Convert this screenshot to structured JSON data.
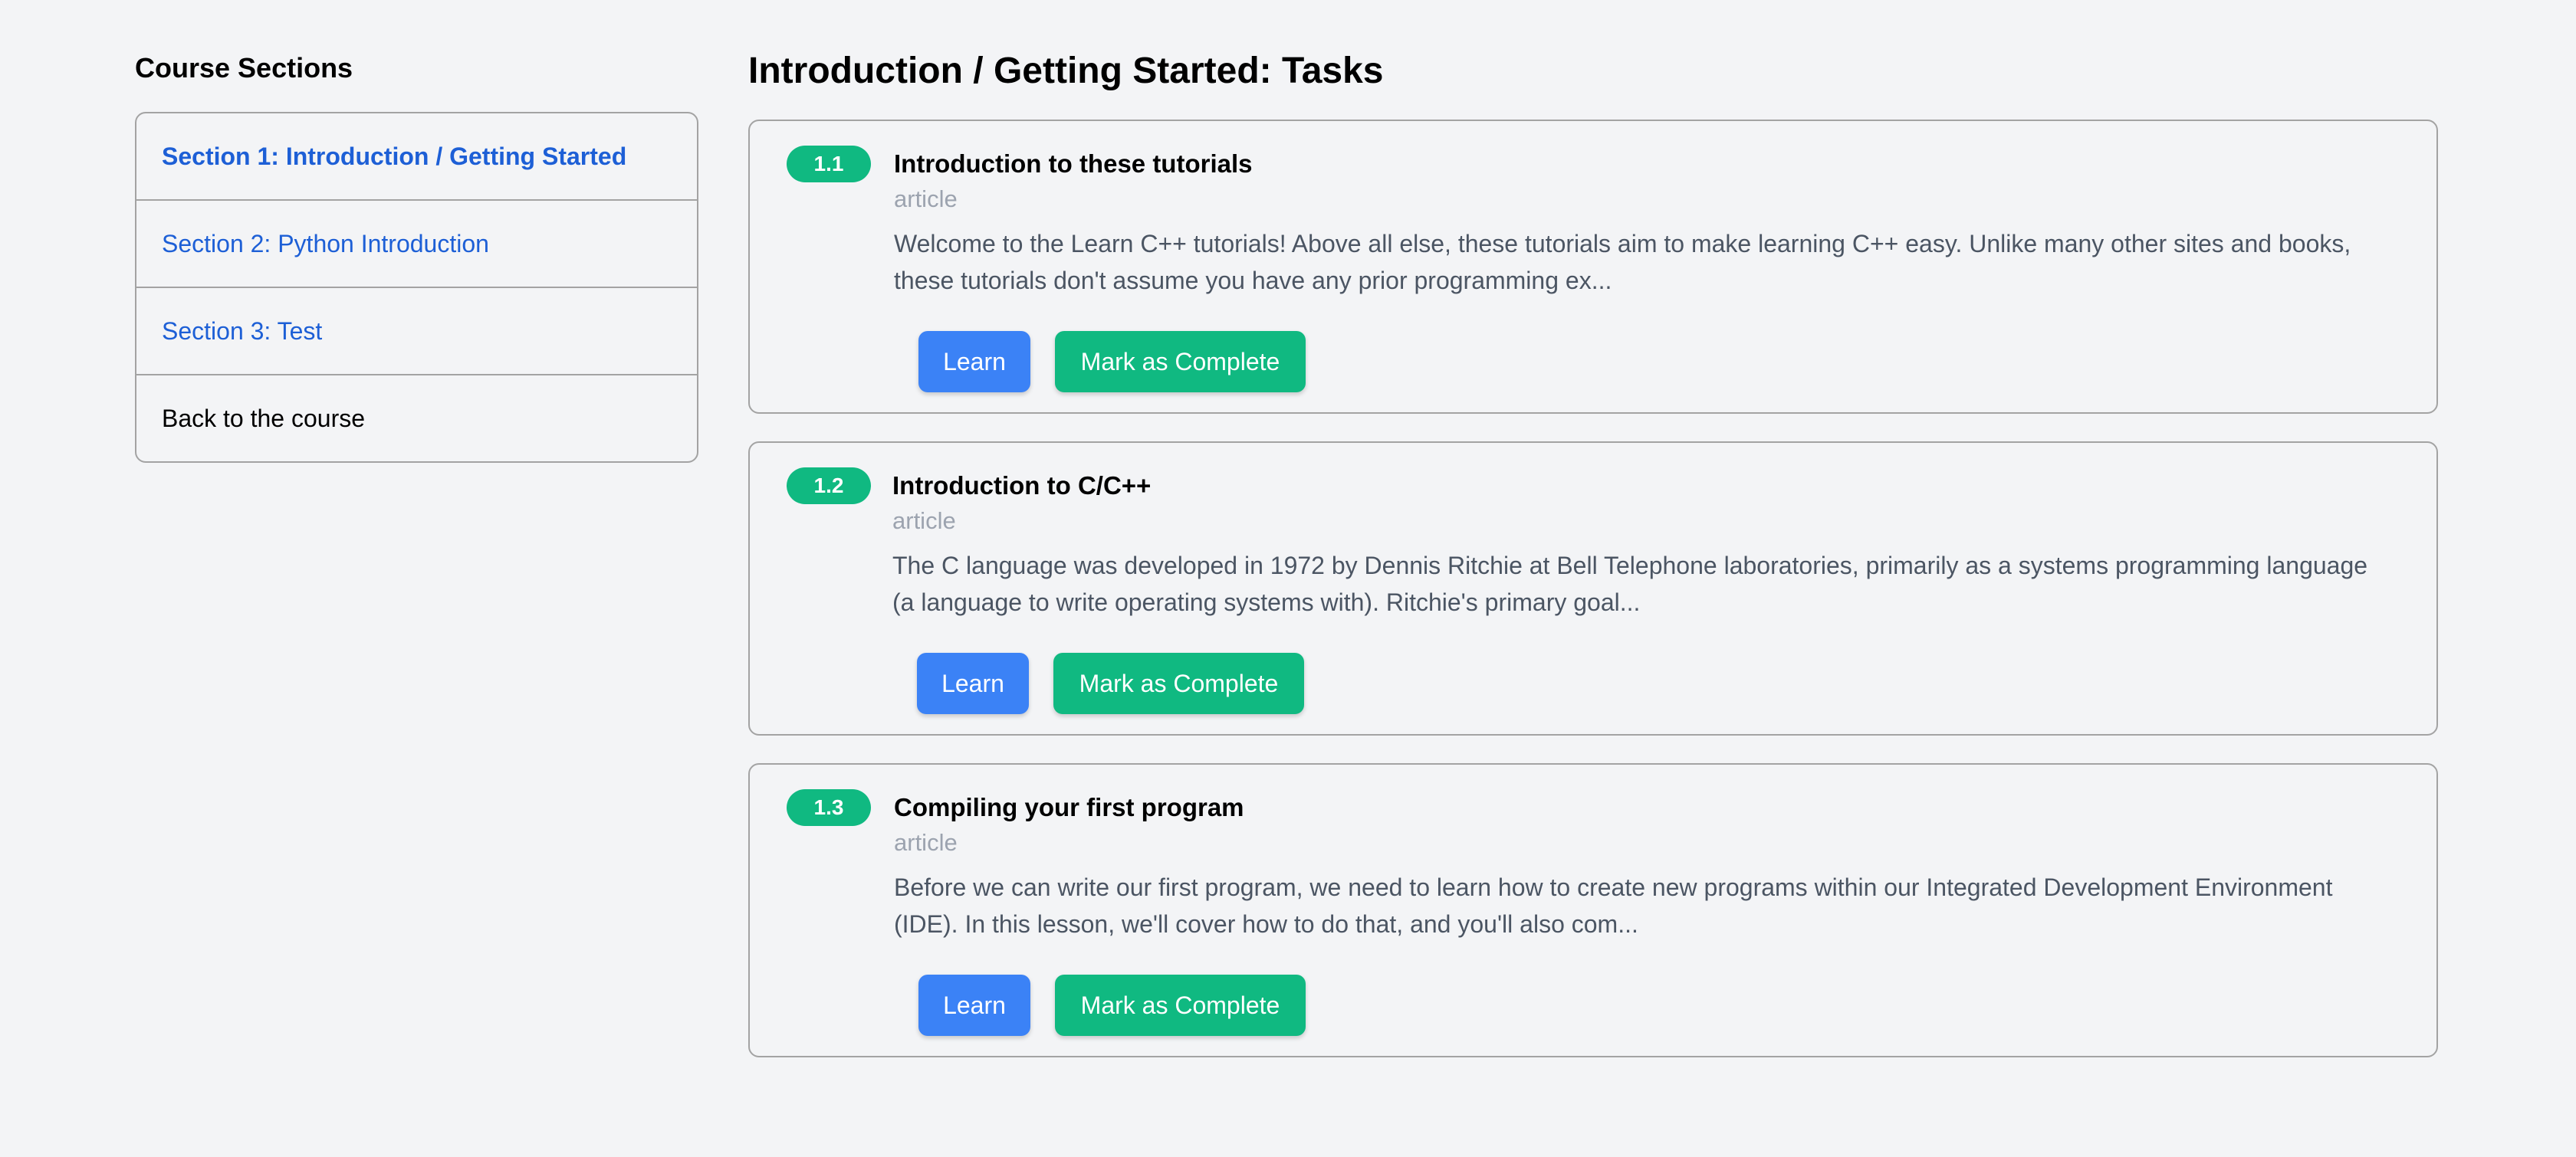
{
  "sidebar": {
    "heading": "Course Sections",
    "items": [
      {
        "label": "Section 1: Introduction / Getting Started",
        "active": true
      },
      {
        "label": "Section 2: Python Introduction",
        "active": false
      },
      {
        "label": "Section 3: Test",
        "active": false
      },
      {
        "label": "Back to the course",
        "active": false
      }
    ]
  },
  "main": {
    "title": "Introduction / Getting Started: Tasks",
    "tasks": [
      {
        "number": "1.1",
        "title": "Introduction to these tutorials",
        "type": "article",
        "description": "Welcome to the Learn C++ tutorials! Above all else, these tutorials aim to make learning C++ easy. Unlike many other sites and books, these tutorials don't assume you have any prior programming ex...",
        "learn_label": "Learn",
        "complete_label": "Mark as Complete"
      },
      {
        "number": "1.2",
        "title": "Introduction to C/C++",
        "type": "article",
        "description": "The C language was developed in 1972 by Dennis Ritchie at Bell Telephone laboratories, primarily as a systems programming language (a language to write operating systems with). Ritchie's primary goal...",
        "learn_label": "Learn",
        "complete_label": "Mark as Complete"
      },
      {
        "number": "1.3",
        "title": "Compiling your first program",
        "type": "article",
        "description": "Before we can write our first program, we need to learn how to create new programs within our Integrated Development Environment (IDE). In this lesson, we'll cover how to do that, and you'll also com...",
        "learn_label": "Learn",
        "complete_label": "Mark as Complete"
      }
    ]
  },
  "colors": {
    "link": "#1d5fd6",
    "badge": "#10b981",
    "learn_button": "#3b82f6",
    "complete_button": "#10b981",
    "background": "#f3f4f6"
  }
}
